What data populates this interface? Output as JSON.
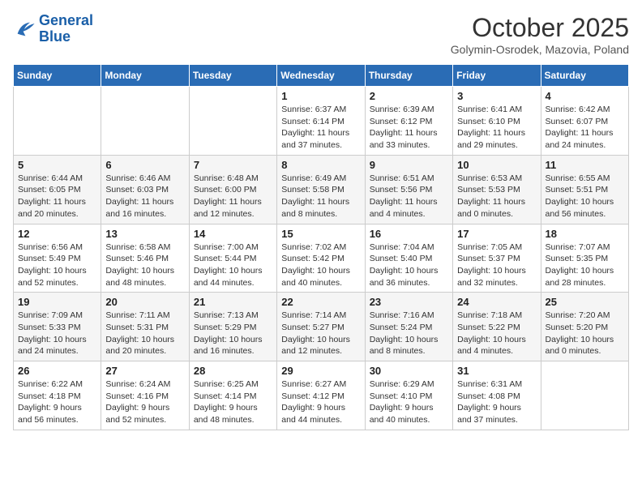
{
  "header": {
    "logo_line1": "General",
    "logo_line2": "Blue",
    "month": "October 2025",
    "location": "Golymin-Osrodek, Mazovia, Poland"
  },
  "weekdays": [
    "Sunday",
    "Monday",
    "Tuesday",
    "Wednesday",
    "Thursday",
    "Friday",
    "Saturday"
  ],
  "weeks": [
    [
      {
        "day": "",
        "sunrise": "",
        "sunset": "",
        "daylight": ""
      },
      {
        "day": "",
        "sunrise": "",
        "sunset": "",
        "daylight": ""
      },
      {
        "day": "",
        "sunrise": "",
        "sunset": "",
        "daylight": ""
      },
      {
        "day": "1",
        "sunrise": "Sunrise: 6:37 AM",
        "sunset": "Sunset: 6:14 PM",
        "daylight": "Daylight: 11 hours and 37 minutes."
      },
      {
        "day": "2",
        "sunrise": "Sunrise: 6:39 AM",
        "sunset": "Sunset: 6:12 PM",
        "daylight": "Daylight: 11 hours and 33 minutes."
      },
      {
        "day": "3",
        "sunrise": "Sunrise: 6:41 AM",
        "sunset": "Sunset: 6:10 PM",
        "daylight": "Daylight: 11 hours and 29 minutes."
      },
      {
        "day": "4",
        "sunrise": "Sunrise: 6:42 AM",
        "sunset": "Sunset: 6:07 PM",
        "daylight": "Daylight: 11 hours and 24 minutes."
      }
    ],
    [
      {
        "day": "5",
        "sunrise": "Sunrise: 6:44 AM",
        "sunset": "Sunset: 6:05 PM",
        "daylight": "Daylight: 11 hours and 20 minutes."
      },
      {
        "day": "6",
        "sunrise": "Sunrise: 6:46 AM",
        "sunset": "Sunset: 6:03 PM",
        "daylight": "Daylight: 11 hours and 16 minutes."
      },
      {
        "day": "7",
        "sunrise": "Sunrise: 6:48 AM",
        "sunset": "Sunset: 6:00 PM",
        "daylight": "Daylight: 11 hours and 12 minutes."
      },
      {
        "day": "8",
        "sunrise": "Sunrise: 6:49 AM",
        "sunset": "Sunset: 5:58 PM",
        "daylight": "Daylight: 11 hours and 8 minutes."
      },
      {
        "day": "9",
        "sunrise": "Sunrise: 6:51 AM",
        "sunset": "Sunset: 5:56 PM",
        "daylight": "Daylight: 11 hours and 4 minutes."
      },
      {
        "day": "10",
        "sunrise": "Sunrise: 6:53 AM",
        "sunset": "Sunset: 5:53 PM",
        "daylight": "Daylight: 11 hours and 0 minutes."
      },
      {
        "day": "11",
        "sunrise": "Sunrise: 6:55 AM",
        "sunset": "Sunset: 5:51 PM",
        "daylight": "Daylight: 10 hours and 56 minutes."
      }
    ],
    [
      {
        "day": "12",
        "sunrise": "Sunrise: 6:56 AM",
        "sunset": "Sunset: 5:49 PM",
        "daylight": "Daylight: 10 hours and 52 minutes."
      },
      {
        "day": "13",
        "sunrise": "Sunrise: 6:58 AM",
        "sunset": "Sunset: 5:46 PM",
        "daylight": "Daylight: 10 hours and 48 minutes."
      },
      {
        "day": "14",
        "sunrise": "Sunrise: 7:00 AM",
        "sunset": "Sunset: 5:44 PM",
        "daylight": "Daylight: 10 hours and 44 minutes."
      },
      {
        "day": "15",
        "sunrise": "Sunrise: 7:02 AM",
        "sunset": "Sunset: 5:42 PM",
        "daylight": "Daylight: 10 hours and 40 minutes."
      },
      {
        "day": "16",
        "sunrise": "Sunrise: 7:04 AM",
        "sunset": "Sunset: 5:40 PM",
        "daylight": "Daylight: 10 hours and 36 minutes."
      },
      {
        "day": "17",
        "sunrise": "Sunrise: 7:05 AM",
        "sunset": "Sunset: 5:37 PM",
        "daylight": "Daylight: 10 hours and 32 minutes."
      },
      {
        "day": "18",
        "sunrise": "Sunrise: 7:07 AM",
        "sunset": "Sunset: 5:35 PM",
        "daylight": "Daylight: 10 hours and 28 minutes."
      }
    ],
    [
      {
        "day": "19",
        "sunrise": "Sunrise: 7:09 AM",
        "sunset": "Sunset: 5:33 PM",
        "daylight": "Daylight: 10 hours and 24 minutes."
      },
      {
        "day": "20",
        "sunrise": "Sunrise: 7:11 AM",
        "sunset": "Sunset: 5:31 PM",
        "daylight": "Daylight: 10 hours and 20 minutes."
      },
      {
        "day": "21",
        "sunrise": "Sunrise: 7:13 AM",
        "sunset": "Sunset: 5:29 PM",
        "daylight": "Daylight: 10 hours and 16 minutes."
      },
      {
        "day": "22",
        "sunrise": "Sunrise: 7:14 AM",
        "sunset": "Sunset: 5:27 PM",
        "daylight": "Daylight: 10 hours and 12 minutes."
      },
      {
        "day": "23",
        "sunrise": "Sunrise: 7:16 AM",
        "sunset": "Sunset: 5:24 PM",
        "daylight": "Daylight: 10 hours and 8 minutes."
      },
      {
        "day": "24",
        "sunrise": "Sunrise: 7:18 AM",
        "sunset": "Sunset: 5:22 PM",
        "daylight": "Daylight: 10 hours and 4 minutes."
      },
      {
        "day": "25",
        "sunrise": "Sunrise: 7:20 AM",
        "sunset": "Sunset: 5:20 PM",
        "daylight": "Daylight: 10 hours and 0 minutes."
      }
    ],
    [
      {
        "day": "26",
        "sunrise": "Sunrise: 6:22 AM",
        "sunset": "Sunset: 4:18 PM",
        "daylight": "Daylight: 9 hours and 56 minutes."
      },
      {
        "day": "27",
        "sunrise": "Sunrise: 6:24 AM",
        "sunset": "Sunset: 4:16 PM",
        "daylight": "Daylight: 9 hours and 52 minutes."
      },
      {
        "day": "28",
        "sunrise": "Sunrise: 6:25 AM",
        "sunset": "Sunset: 4:14 PM",
        "daylight": "Daylight: 9 hours and 48 minutes."
      },
      {
        "day": "29",
        "sunrise": "Sunrise: 6:27 AM",
        "sunset": "Sunset: 4:12 PM",
        "daylight": "Daylight: 9 hours and 44 minutes."
      },
      {
        "day": "30",
        "sunrise": "Sunrise: 6:29 AM",
        "sunset": "Sunset: 4:10 PM",
        "daylight": "Daylight: 9 hours and 40 minutes."
      },
      {
        "day": "31",
        "sunrise": "Sunrise: 6:31 AM",
        "sunset": "Sunset: 4:08 PM",
        "daylight": "Daylight: 9 hours and 37 minutes."
      },
      {
        "day": "",
        "sunrise": "",
        "sunset": "",
        "daylight": ""
      }
    ]
  ]
}
